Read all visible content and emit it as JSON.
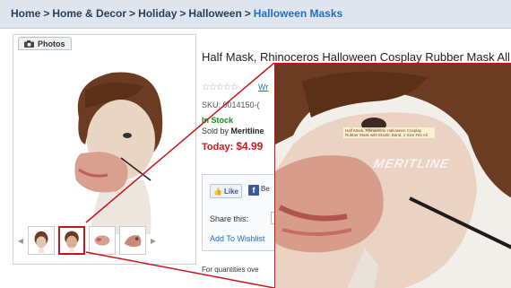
{
  "breadcrumb": {
    "items": [
      "Home",
      "Home & Decor",
      "Holiday",
      "Halloween"
    ],
    "current": "Halloween Masks",
    "separator": ">"
  },
  "photos_tab": {
    "label": "Photos",
    "icon": "camera-icon"
  },
  "product": {
    "title": "Half Mask, Rhinoceros Halloween Cosplay Rubber Mask All",
    "rating_stars": "☆☆☆☆☆",
    "reviews_link": "Wr",
    "sku": "SKU: 0014150-(",
    "stock": "In Stock",
    "sold_by_prefix": "Sold by",
    "sold_by_name": "Meritline",
    "price_label": "Today:",
    "price": "$4.99"
  },
  "share": {
    "like_label": "Like",
    "fb_text": "Be",
    "share_label": "Share this:",
    "wishlist_label": "Add To Wishlist"
  },
  "quantity_note": "For quantities ove",
  "zoom": {
    "label_text": "Half Mask, Rhinoceros Halloween Cosplay Rubber Mask with Elastic Band, 1 Size Fits All",
    "watermark": "MERITLINE"
  },
  "colors": {
    "highlight": "#c8141a",
    "link": "#1f6fc7",
    "price": "#d4151c",
    "stock": "#1e8a1e"
  }
}
